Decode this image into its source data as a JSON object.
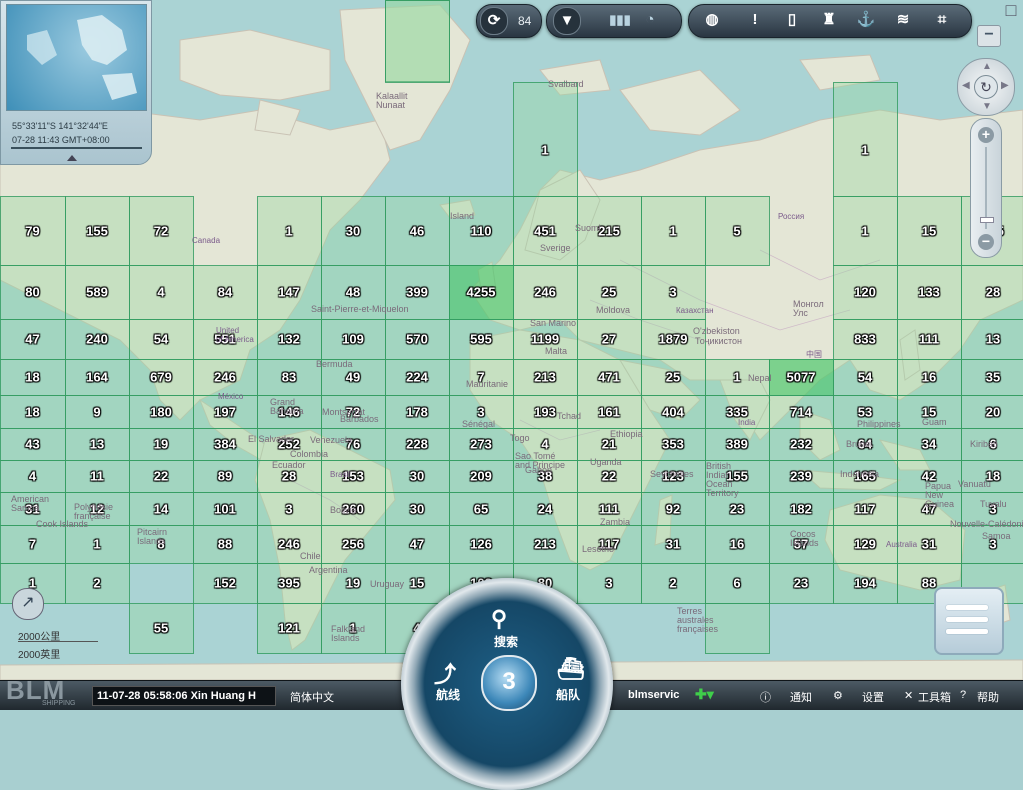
{
  "map": {
    "labels": [
      {
        "t": "Kalaallit\nNunaat",
        "c": ""
      },
      {
        "t": "Canada",
        "c": "country"
      },
      {
        "t": "Island",
        "c": ""
      },
      {
        "t": "Россия",
        "c": "country"
      },
      {
        "t": "United\nof America",
        "c": "country"
      },
      {
        "t": "Saint-Pierre-et-Miquelon",
        "c": ""
      },
      {
        "t": "Bermuda",
        "c": ""
      },
      {
        "t": "México",
        "c": "country"
      },
      {
        "t": "Казахстан",
        "c": "country"
      },
      {
        "t": "Монгол\nУлс",
        "c": ""
      },
      {
        "t": "中国",
        "c": "country"
      },
      {
        "t": "Svalbard",
        "c": ""
      },
      {
        "t": "Suomi",
        "c": ""
      },
      {
        "t": "Sverige",
        "c": ""
      },
      {
        "t": "San Marino",
        "c": ""
      },
      {
        "t": "Moldova",
        "c": ""
      },
      {
        "t": "Malta",
        "c": ""
      },
      {
        "t": "O'zbekiston",
        "c": ""
      },
      {
        "t": "Тоҷикистон",
        "c": ""
      },
      {
        "t": "India",
        "c": "country"
      },
      {
        "t": "Philippines",
        "c": ""
      },
      {
        "t": "Guam",
        "c": ""
      },
      {
        "t": "Nepal",
        "c": ""
      },
      {
        "t": "Barbados",
        "c": ""
      },
      {
        "t": "El Salvador",
        "c": ""
      },
      {
        "t": "Venezuela",
        "c": ""
      },
      {
        "t": "Colombia",
        "c": ""
      },
      {
        "t": "Ecuador",
        "c": ""
      },
      {
        "t": "Brasil",
        "c": "country"
      },
      {
        "t": "Bolivia",
        "c": ""
      },
      {
        "t": "Chile",
        "c": ""
      },
      {
        "t": "Argentina",
        "c": ""
      },
      {
        "t": "Uruguay",
        "c": ""
      },
      {
        "t": "Falkland\nIslands",
        "c": ""
      },
      {
        "t": "Pitcairn\nIslands",
        "c": ""
      },
      {
        "t": "American\nSamoa",
        "c": ""
      },
      {
        "t": "Cook Islands",
        "c": ""
      },
      {
        "t": "Polynésie\nfrançaise",
        "c": ""
      },
      {
        "t": "Ethiopia",
        "c": ""
      },
      {
        "t": "Tchad",
        "c": ""
      },
      {
        "t": "Sénégal",
        "c": ""
      },
      {
        "t": "Togo",
        "c": ""
      },
      {
        "t": "Uganda",
        "c": ""
      },
      {
        "t": "Zambia",
        "c": ""
      },
      {
        "t": "Lesotho",
        "c": ""
      },
      {
        "t": "Seychelles",
        "c": ""
      },
      {
        "t": "British\nIndian\nOcean\nTerritory",
        "c": ""
      },
      {
        "t": "Australia",
        "c": "country"
      },
      {
        "t": "Nouvelle-Calédonie",
        "c": ""
      },
      {
        "t": "Terres\naustrales\nfrançaises",
        "c": ""
      },
      {
        "t": "Cocos\nIslands",
        "c": ""
      },
      {
        "t": "Grand\nBahama",
        "c": ""
      },
      {
        "t": "Montserrat",
        "c": ""
      },
      {
        "t": "Gabon",
        "c": ""
      },
      {
        "t": "Sao Tomé\nand Principe",
        "c": ""
      },
      {
        "t": "Mauritanie",
        "c": ""
      },
      {
        "t": "Kiribati",
        "c": ""
      },
      {
        "t": "Vanuatu",
        "c": ""
      },
      {
        "t": "Tuvalu",
        "c": ""
      },
      {
        "t": "Samoa",
        "c": ""
      },
      {
        "t": "Indonesia",
        "c": ""
      },
      {
        "t": "Papua\nNew\nGuinea",
        "c": ""
      },
      {
        "t": "Brunei",
        "c": ""
      }
    ],
    "cells": [
      {
        "v": ""
      },
      {
        "v": "1"
      },
      {
        "v": "1"
      },
      {
        "v": "79"
      },
      {
        "v": "155"
      },
      {
        "v": "72"
      },
      {
        "v": "1"
      },
      {
        "v": "30"
      },
      {
        "v": "46"
      },
      {
        "v": "110"
      },
      {
        "v": "451"
      },
      {
        "v": "215"
      },
      {
        "v": "1"
      },
      {
        "v": "5"
      },
      {
        "v": "1"
      },
      {
        "v": "15"
      },
      {
        "v": "175"
      },
      {
        "v": "80"
      },
      {
        "v": "589"
      },
      {
        "v": "4"
      },
      {
        "v": "84"
      },
      {
        "v": "147"
      },
      {
        "v": "48"
      },
      {
        "v": "399"
      },
      {
        "v": "4255"
      },
      {
        "v": "246"
      },
      {
        "v": "25"
      },
      {
        "v": "3"
      },
      {
        "v": "120"
      },
      {
        "v": "133"
      },
      {
        "v": "28"
      },
      {
        "v": "47"
      },
      {
        "v": "240"
      },
      {
        "v": "54"
      },
      {
        "v": "551"
      },
      {
        "v": "132"
      },
      {
        "v": "109"
      },
      {
        "v": "570"
      },
      {
        "v": "595"
      },
      {
        "v": "1199"
      },
      {
        "v": "27"
      },
      {
        "v": "1879"
      },
      {
        "v": "833"
      },
      {
        "v": "111"
      },
      {
        "v": "13"
      },
      {
        "v": "18"
      },
      {
        "v": "164"
      },
      {
        "v": "679"
      },
      {
        "v": "246"
      },
      {
        "v": "83"
      },
      {
        "v": "49"
      },
      {
        "v": "224"
      },
      {
        "v": "7"
      },
      {
        "v": "213"
      },
      {
        "v": "471"
      },
      {
        "v": "25"
      },
      {
        "v": "1"
      },
      {
        "v": "5077"
      },
      {
        "v": "54"
      },
      {
        "v": "16"
      },
      {
        "v": "35"
      },
      {
        "v": "18"
      },
      {
        "v": "9"
      },
      {
        "v": "180"
      },
      {
        "v": "197"
      },
      {
        "v": "146"
      },
      {
        "v": "72"
      },
      {
        "v": "178"
      },
      {
        "v": "3"
      },
      {
        "v": "193"
      },
      {
        "v": "161"
      },
      {
        "v": "404"
      },
      {
        "v": "335"
      },
      {
        "v": "714"
      },
      {
        "v": "53"
      },
      {
        "v": "15"
      },
      {
        "v": "20"
      },
      {
        "v": "43"
      },
      {
        "v": "13"
      },
      {
        "v": "19"
      },
      {
        "v": "384"
      },
      {
        "v": "252"
      },
      {
        "v": "76"
      },
      {
        "v": "228"
      },
      {
        "v": "273"
      },
      {
        "v": "4"
      },
      {
        "v": "21"
      },
      {
        "v": "353"
      },
      {
        "v": "389"
      },
      {
        "v": "232"
      },
      {
        "v": "64"
      },
      {
        "v": "34"
      },
      {
        "v": "6"
      },
      {
        "v": "4"
      },
      {
        "v": "11"
      },
      {
        "v": "22"
      },
      {
        "v": "89"
      },
      {
        "v": "28"
      },
      {
        "v": "153"
      },
      {
        "v": "30"
      },
      {
        "v": "209"
      },
      {
        "v": "38"
      },
      {
        "v": "22"
      },
      {
        "v": "123"
      },
      {
        "v": "155"
      },
      {
        "v": "239"
      },
      {
        "v": "165"
      },
      {
        "v": "42"
      },
      {
        "v": "18"
      },
      {
        "v": "31"
      },
      {
        "v": "12"
      },
      {
        "v": "14"
      },
      {
        "v": "101"
      },
      {
        "v": "3"
      },
      {
        "v": "260"
      },
      {
        "v": "30"
      },
      {
        "v": "65"
      },
      {
        "v": "24"
      },
      {
        "v": "111"
      },
      {
        "v": "92"
      },
      {
        "v": "23"
      },
      {
        "v": "182"
      },
      {
        "v": "117"
      },
      {
        "v": "47"
      },
      {
        "v": "3"
      },
      {
        "v": "7"
      },
      {
        "v": "1"
      },
      {
        "v": "8"
      },
      {
        "v": "88"
      },
      {
        "v": "246"
      },
      {
        "v": "256"
      },
      {
        "v": "47"
      },
      {
        "v": "126"
      },
      {
        "v": "213"
      },
      {
        "v": "117"
      },
      {
        "v": "31"
      },
      {
        "v": "16"
      },
      {
        "v": "57"
      },
      {
        "v": "129"
      },
      {
        "v": "31"
      },
      {
        "v": "3"
      },
      {
        "v": "1"
      },
      {
        "v": "2"
      },
      {
        "v": "152"
      },
      {
        "v": "395"
      },
      {
        "v": "19"
      },
      {
        "v": "15"
      },
      {
        "v": "108"
      },
      {
        "v": "80"
      },
      {
        "v": "3"
      },
      {
        "v": "2"
      },
      {
        "v": "6"
      },
      {
        "v": "23"
      },
      {
        "v": "194"
      },
      {
        "v": "88"
      },
      {
        "v": ""
      },
      {
        "v": "55"
      },
      {
        "v": "121"
      },
      {
        "v": "1"
      },
      {
        "v": "4"
      }
    ]
  },
  "minimap": {
    "coordinates": "55°33'11\"S 141°32'44\"E",
    "datetime": "07-28 11:43 GMT+08:00"
  },
  "toolbar": {
    "refresh_count": "84",
    "icons": [
      "refresh-icon",
      "filter-icon",
      "signal-bars-icon",
      "radar-icon",
      "globe-icon",
      "alert-icon",
      "ruler-icon",
      "lighthouse-icon",
      "anchor-icon",
      "weather-icon",
      "screen-capture-icon"
    ]
  },
  "scale": {
    "metric": "2000公里",
    "nautical": "2000英里"
  },
  "dial": {
    "search": "搜索",
    "route": "航线",
    "fleet": "船队",
    "center_logo": "3"
  },
  "bottom": {
    "logo": "BLM",
    "logo_sub": "SHIPPING",
    "status": "11-07-28 05:58:06 Xin Huang H",
    "language": "简体中文",
    "user": "blmservic",
    "notify": "通知",
    "settings": "设置",
    "toolbox": "工具箱",
    "help": "帮助"
  },
  "colors": {
    "grid": "#2e9a60",
    "hot_cell": "#5ac86e",
    "bar": "#2a353d"
  }
}
